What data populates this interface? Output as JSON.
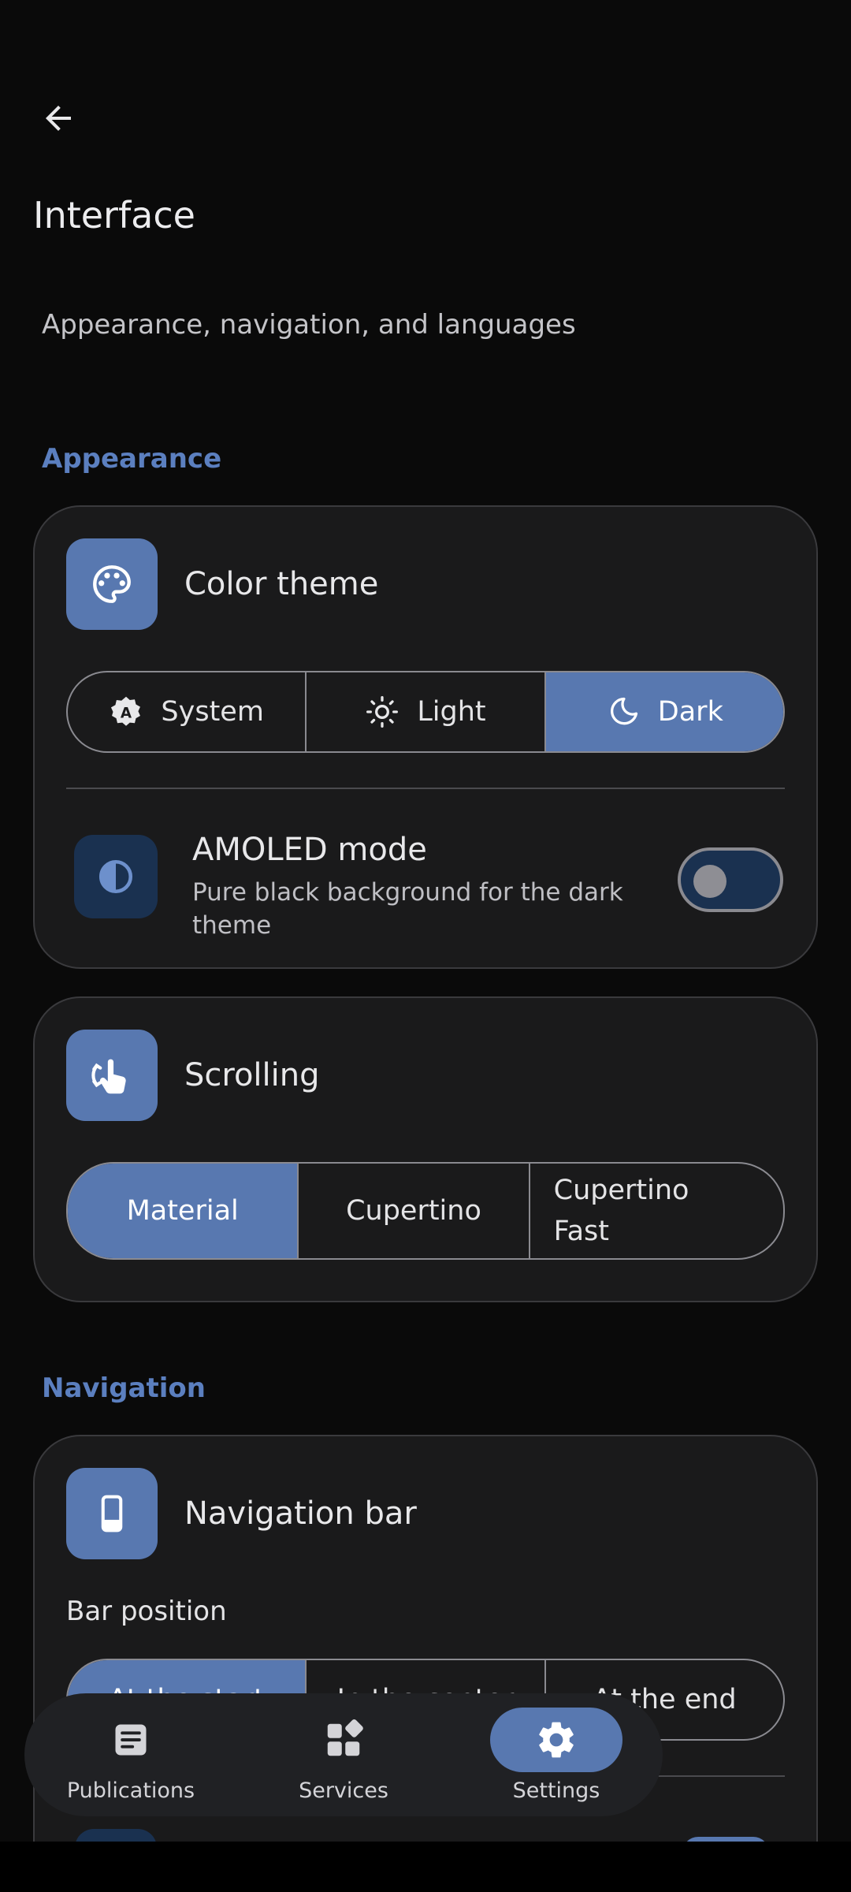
{
  "header": {
    "title": "Interface",
    "subtitle": "Appearance, navigation, and languages"
  },
  "sections": {
    "appearance": "Appearance",
    "navigation": "Navigation"
  },
  "color_theme": {
    "title": "Color theme",
    "options": [
      "System",
      "Light",
      "Dark"
    ],
    "selected": "Dark",
    "amoled_title": "AMOLED mode",
    "amoled_desc": "Pure black background for the dark theme",
    "amoled_enabled": false
  },
  "scrolling": {
    "title": "Scrolling",
    "options": [
      "Material",
      "Cupertino",
      "Cupertino Fast"
    ],
    "selected": "Material"
  },
  "navigation_bar": {
    "title": "Navigation bar",
    "bar_position_label": "Bar position",
    "options": [
      "At the start",
      "In the center",
      "At the end"
    ],
    "selected": "At the start"
  },
  "bottom_nav": {
    "items": [
      "Publications",
      "Services",
      "Settings"
    ],
    "active": "Settings"
  },
  "colors": {
    "accent": "#5878b0",
    "section_label": "#5b7fbf",
    "background": "#0a0a0a",
    "card": "#1a1a1b"
  }
}
